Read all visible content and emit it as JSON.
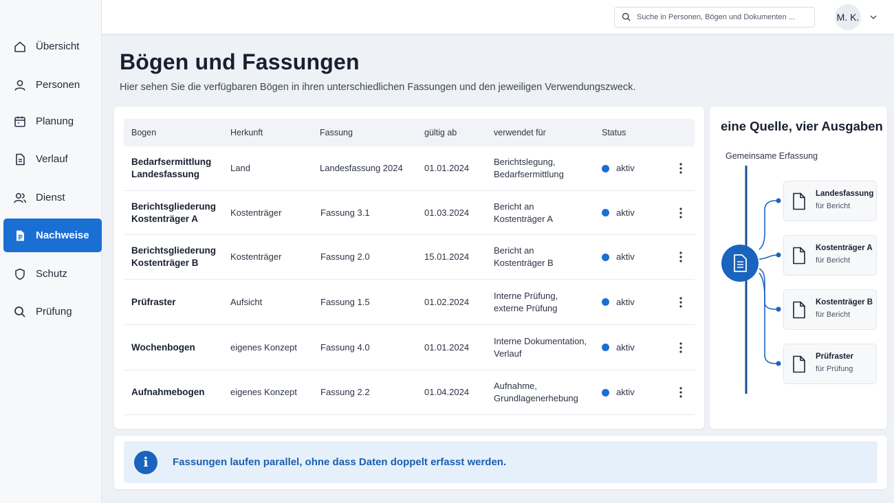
{
  "sidebar": {
    "items": [
      {
        "label": "Übersicht",
        "icon": "home-icon"
      },
      {
        "label": "Personen",
        "icon": "user-icon"
      },
      {
        "label": "Planung",
        "icon": "calendar-icon"
      },
      {
        "label": "Verlauf",
        "icon": "document-icon"
      },
      {
        "label": "Dienst",
        "icon": "users-icon"
      },
      {
        "label": "Nachweise",
        "icon": "document-list-icon",
        "active": true
      },
      {
        "label": "Schutz",
        "icon": "shield-icon"
      },
      {
        "label": "Prüfung",
        "icon": "search-icon"
      }
    ]
  },
  "header": {
    "search_placeholder": "Suche in Personen, Bögen und Dokumenten ...",
    "user_initials": "M. K."
  },
  "page": {
    "title": "Bögen und Fassungen",
    "subtitle": "Hier sehen Sie die verfügbaren Bögen in ihren unterschiedlichen Fassungen und den jeweiligen Verwendungszweck."
  },
  "table": {
    "columns": [
      "Bogen",
      "Herkunft",
      "Fassung",
      "gültig ab",
      "verwendet für",
      "Status"
    ],
    "rows": [
      {
        "bogen": "Bedarfsermittlung\nLandesfassung",
        "herkunft": "Land",
        "fassung": "Landesfassung 2024",
        "gueltig": "01.01.2024",
        "verwendet": "Berichtslegung,\nBedarfsermittlung",
        "status": "aktiv"
      },
      {
        "bogen": "Berichtsgliederung\nKostenträger A",
        "herkunft": "Kostenträger",
        "fassung": "Fassung 3.1",
        "gueltig": "01.03.2024",
        "verwendet": "Bericht an\nKostenträger A",
        "status": "aktiv"
      },
      {
        "bogen": "Berichtsgliederung\nKostenträger B",
        "herkunft": "Kostenträger",
        "fassung": "Fassung 2.0",
        "gueltig": "15.01.2024",
        "verwendet": "Bericht an\nKostenträger B",
        "status": "aktiv"
      },
      {
        "bogen": "Prüfraster",
        "herkunft": "Aufsicht",
        "fassung": "Fassung 1.5",
        "gueltig": "01.02.2024",
        "verwendet": "Interne Prüfung,\nexterne Prüfung",
        "status": "aktiv"
      },
      {
        "bogen": "Wochenbogen",
        "herkunft": "eigenes Konzept",
        "fassung": "Fassung 4.0",
        "gueltig": "01.01.2024",
        "verwendet": "Interne Dokumentation,\nVerlauf",
        "status": "aktiv"
      },
      {
        "bogen": "Aufnahmebogen",
        "herkunft": "eigenes Konzept",
        "fassung": "Fassung 2.2",
        "gueltig": "01.04.2024",
        "verwendet": "Aufnahme,\nGrundlagenerhebung",
        "status": "aktiv"
      }
    ]
  },
  "panel": {
    "title": "eine Quelle, vier Ausgaben",
    "source_label": "Gemeinsame Erfassung",
    "outputs": [
      {
        "title": "Landesfassung",
        "subtitle": "für Bericht"
      },
      {
        "title": "Kostenträger A",
        "subtitle": "für Bericht"
      },
      {
        "title": "Kostenträger B",
        "subtitle": "für Bericht"
      },
      {
        "title": "Prüfraster",
        "subtitle": "für Prüfung"
      }
    ]
  },
  "info": {
    "icon": "info-icon",
    "text": "Fassungen laufen parallel, ohne dass Daten doppelt erfasst werden."
  },
  "colors": {
    "accent": "#1a6fd4",
    "accent_dark": "#1a5fb0",
    "info_bg": "#e6f0fb",
    "status_dot": "#1a6fd4"
  }
}
